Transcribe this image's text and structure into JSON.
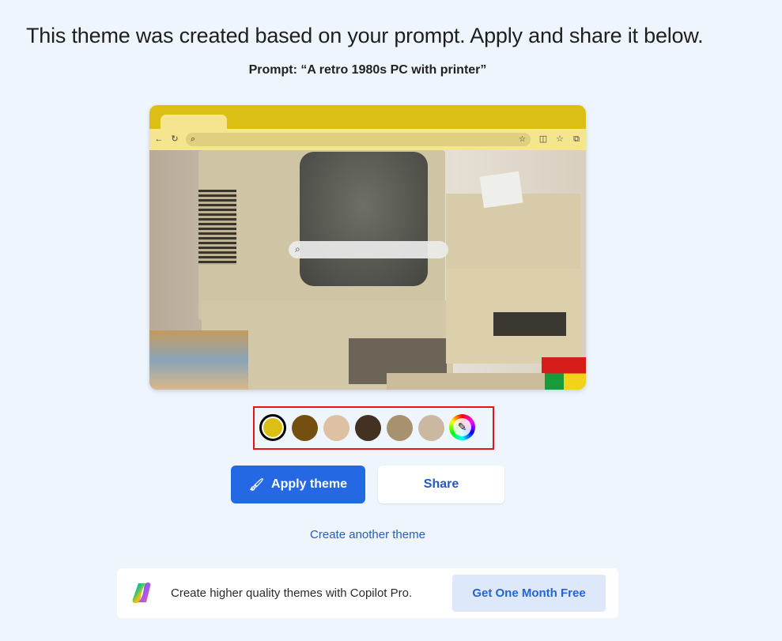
{
  "header": {
    "title": "This theme was created based on your prompt. Apply and share it below.",
    "prompt": "Prompt: “A retro 1980s PC with printer”"
  },
  "preview": {
    "image_alt": "Retro 1980s beige PC with CRT monitor, dot-matrix printer, floppy folders and a Rubik's cube",
    "toolbar_icons": [
      "back-icon",
      "refresh-icon",
      "search-icon",
      "favorite-add-icon",
      "split-screen-icon",
      "favorites-icon",
      "collections-icon"
    ],
    "theme_colors": {
      "frame": "#dcbf14",
      "toolbar": "#f5e58e",
      "omnibox": "#dfcf7e"
    }
  },
  "swatches": {
    "selected_index": 0,
    "colors": [
      "#dcbf14",
      "#744f10",
      "#dcc1a2",
      "#433122",
      "#a8916f",
      "#cbb8a0"
    ],
    "custom_picker_icon": "eyedropper-icon"
  },
  "actions": {
    "apply_label": "Apply theme",
    "share_label": "Share",
    "create_another_label": "Create another theme"
  },
  "promo": {
    "text": "Create higher quality themes with Copilot Pro.",
    "cta_label": "Get One Month Free"
  }
}
